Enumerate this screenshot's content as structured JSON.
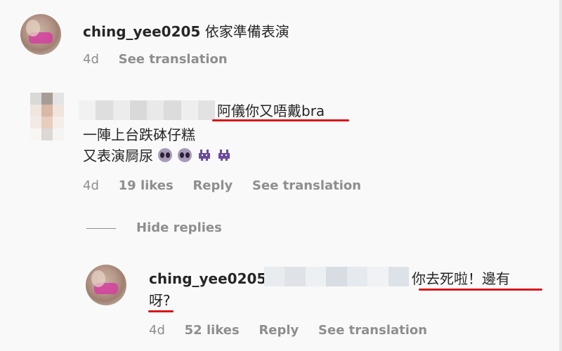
{
  "comments": [
    {
      "username": "ching_yee0205",
      "text": "依家準備表演",
      "meta": {
        "time": "4d",
        "translation": "See translation"
      }
    },
    {
      "text_line1": "阿儀你又唔戴bra",
      "text_line2": "一陣上台跌砵仔糕",
      "text_line3": "又表演屙尿",
      "emojis": [
        "alien-emoji",
        "alien-emoji",
        "alien-monster-emoji",
        "alien-monster-emoji"
      ],
      "meta": {
        "time": "4d",
        "likes": "19 likes",
        "reply": "Reply",
        "translation": "See translation"
      }
    }
  ],
  "hide_replies": "Hide replies",
  "reply": {
    "username": "ching_yee0205",
    "text_part1": "你去死啦！邊有",
    "text_part2": "呀?",
    "meta": {
      "time": "4d",
      "likes": "52 likes",
      "reply": "Reply",
      "translation": "See translation"
    }
  },
  "colors": {
    "underline": "#d8161b",
    "meta_text": "#8e8e8e",
    "text": "#262626"
  }
}
